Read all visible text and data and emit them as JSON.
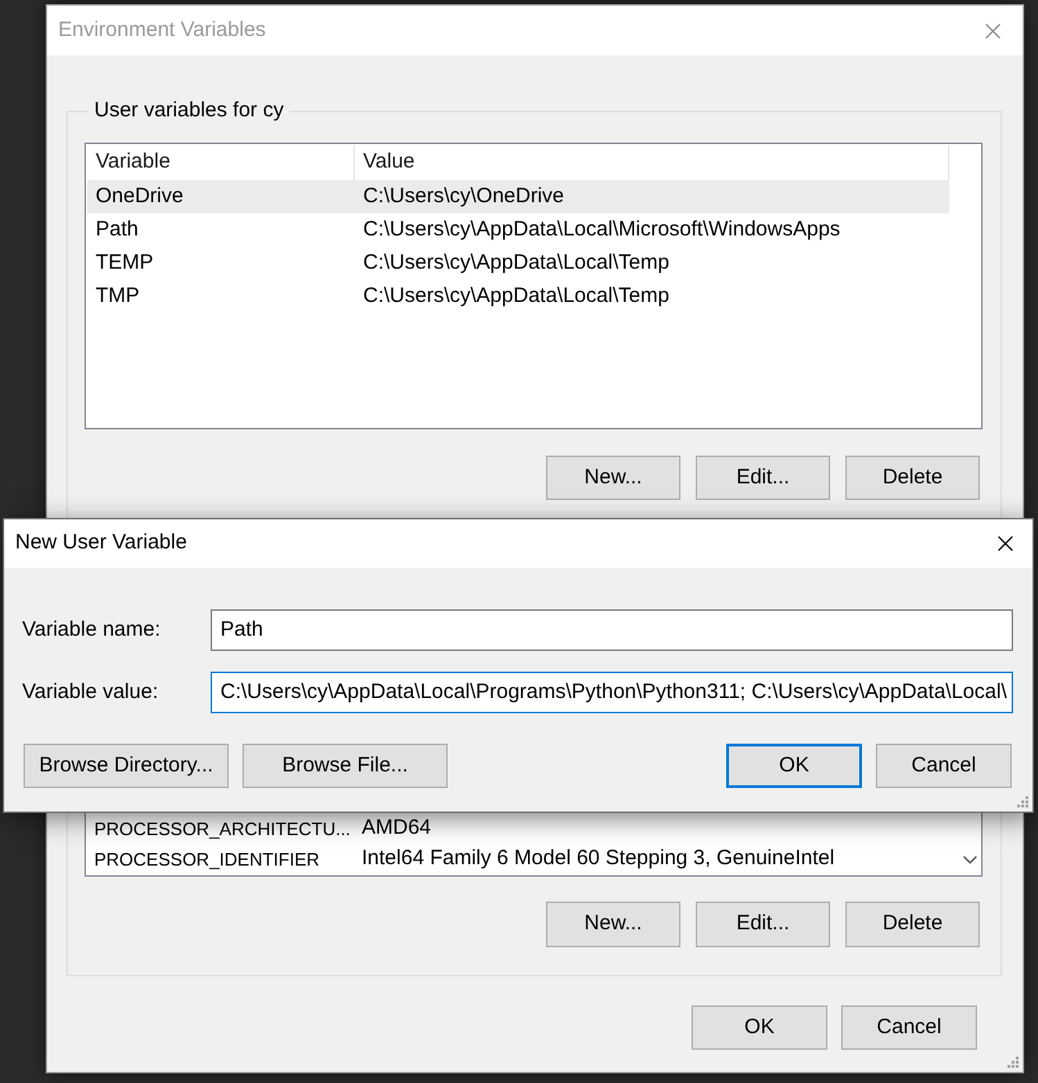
{
  "main_window": {
    "title": "Environment Variables",
    "active": false,
    "user_variables": {
      "label": "User variables for cy",
      "columns": [
        "Variable",
        "Value"
      ],
      "rows": [
        {
          "variable": "OneDrive",
          "value": "C:\\Users\\cy\\OneDrive",
          "selected": true
        },
        {
          "variable": "Path",
          "value": "C:\\Users\\cy\\AppData\\Local\\Microsoft\\WindowsApps",
          "selected": false
        },
        {
          "variable": "TEMP",
          "value": "C:\\Users\\cy\\AppData\\Local\\Temp",
          "selected": false
        },
        {
          "variable": "TMP",
          "value": "C:\\Users\\cy\\AppData\\Local\\Temp",
          "selected": false
        }
      ],
      "buttons": [
        {
          "label": "New..."
        },
        {
          "label": "Edit..."
        },
        {
          "label": "Delete"
        }
      ]
    },
    "system_variables": {
      "rows": [
        {
          "variable": "PROCESSOR_ARCHITECTU...",
          "value": "AMD64",
          "selected": false
        },
        {
          "variable": "PROCESSOR_IDENTIFIER",
          "value": "Intel64 Family 6 Model 60 Stepping 3, GenuineIntel",
          "selected": false
        }
      ],
      "buttons": [
        {
          "label": "New..."
        },
        {
          "label": "Edit..."
        },
        {
          "label": "Delete"
        }
      ]
    },
    "buttons": [
      {
        "label": "OK",
        "default": false
      },
      {
        "label": "Cancel",
        "default": false
      }
    ]
  },
  "dialog": {
    "title": "New User Variable",
    "active": true,
    "fields": [
      {
        "label": "Variable name:",
        "value": "Path",
        "focused": false
      },
      {
        "label": "Variable value:",
        "value": "C:\\Users\\cy\\AppData\\Local\\Programs\\Python\\Python311; C:\\Users\\cy\\AppData\\Local\\",
        "focused": true
      }
    ],
    "buttons": [
      {
        "label": "Browse Directory...",
        "default": false
      },
      {
        "label": "Browse File...",
        "default": false
      },
      {
        "label": "OK",
        "default": true
      },
      {
        "label": "Cancel",
        "default": false
      }
    ]
  }
}
